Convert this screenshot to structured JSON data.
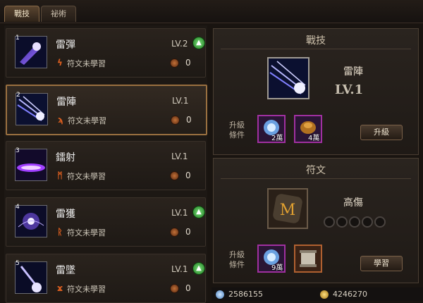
{
  "tabs": [
    "戰技",
    "祕術"
  ],
  "skills": [
    {
      "num": "1",
      "name": "雷彈",
      "lv": "LV.2",
      "rune": "符文未學習",
      "count": "0",
      "selected": false
    },
    {
      "num": "2",
      "name": "雷陣",
      "lv": "LV.1",
      "rune": "符文未學習",
      "count": "0",
      "selected": true
    },
    {
      "num": "3",
      "name": "鐳射",
      "lv": "LV.1",
      "rune": "符文未學習",
      "count": "0",
      "selected": false
    },
    {
      "num": "4",
      "name": "雷獲",
      "lv": "LV.1",
      "rune": "符文未學習",
      "count": "0",
      "selected": false
    },
    {
      "num": "5",
      "name": "雷墜",
      "lv": "LV.1",
      "rune": "符文未學習",
      "count": "0",
      "selected": false
    }
  ],
  "skill_panel": {
    "title": "戰技",
    "skill_name": "雷陣",
    "level": "LV.1",
    "condition_label_1": "升級",
    "condition_label_2": "條件",
    "req1": "2萬",
    "req2": "4萬",
    "button": "升級"
  },
  "rune_panel": {
    "title": "符文",
    "rune_name": "高傷",
    "condition_label_1": "升級",
    "condition_label_2": "條件",
    "req1": "9萬",
    "button": "學習"
  },
  "currency": {
    "blue": "2586155",
    "gold": "4246270"
  },
  "colors": {
    "accent": "#9a7040",
    "upgrade_green": "#1f7a20"
  }
}
